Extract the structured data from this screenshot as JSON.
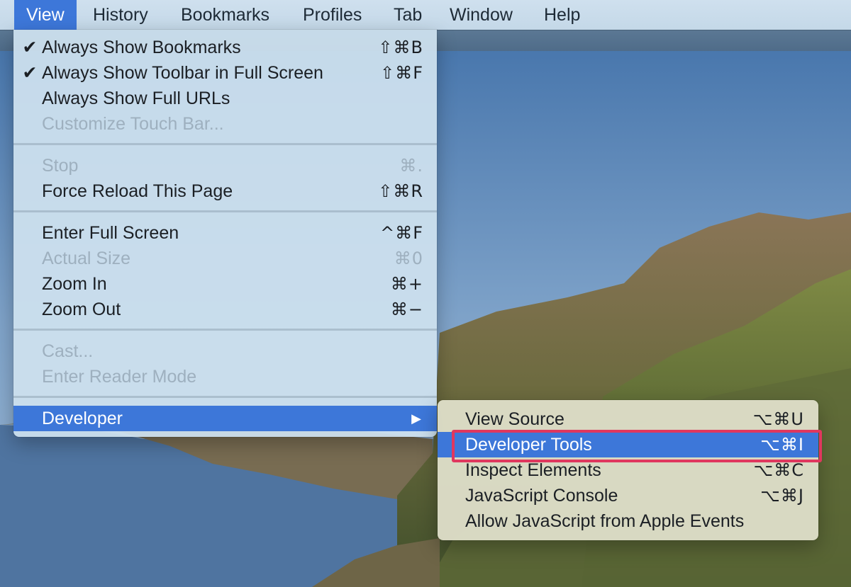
{
  "menubar": {
    "items": [
      "View",
      "History",
      "Bookmarks",
      "Profiles",
      "Tab",
      "Window",
      "Help"
    ],
    "active": "View"
  },
  "view_menu": {
    "groups": [
      [
        {
          "label": "Always Show Bookmarks",
          "shortcut": "⇧⌘B",
          "checked": true,
          "enabled": true
        },
        {
          "label": "Always Show Toolbar in Full Screen",
          "shortcut": "⇧⌘F",
          "checked": true,
          "enabled": true
        },
        {
          "label": "Always Show Full URLs",
          "shortcut": "",
          "checked": false,
          "enabled": true
        },
        {
          "label": "Customize Touch Bar...",
          "shortcut": "",
          "checked": false,
          "enabled": false
        }
      ],
      [
        {
          "label": "Stop",
          "shortcut": "⌘.",
          "checked": false,
          "enabled": false
        },
        {
          "label": "Force Reload This Page",
          "shortcut": "⇧⌘R",
          "checked": false,
          "enabled": true
        }
      ],
      [
        {
          "label": "Enter Full Screen",
          "shortcut": "^⌘F",
          "checked": false,
          "enabled": true
        },
        {
          "label": "Actual Size",
          "shortcut": "⌘0",
          "checked": false,
          "enabled": false
        },
        {
          "label": "Zoom In",
          "shortcut": "⌘+",
          "checked": false,
          "enabled": true
        },
        {
          "label": "Zoom Out",
          "shortcut": "⌘−",
          "checked": false,
          "enabled": true
        }
      ],
      [
        {
          "label": "Cast...",
          "shortcut": "",
          "checked": false,
          "enabled": false
        },
        {
          "label": "Enter Reader Mode",
          "shortcut": "",
          "checked": false,
          "enabled": false
        }
      ]
    ],
    "developer": {
      "label": "Developer",
      "submenu_arrow": "▶"
    }
  },
  "developer_submenu": {
    "items": [
      {
        "label": "View Source",
        "shortcut": "⌥⌘U",
        "highlighted": false
      },
      {
        "label": "Developer Tools",
        "shortcut": "⌥⌘I",
        "highlighted": true
      },
      {
        "label": "Inspect Elements",
        "shortcut": "⌥⌘C",
        "highlighted": false
      },
      {
        "label": "JavaScript Console",
        "shortcut": "⌥⌘J",
        "highlighted": false
      },
      {
        "label": "Allow JavaScript from Apple Events",
        "shortcut": "",
        "highlighted": false
      }
    ]
  },
  "icons": {
    "checkmark": "checkmark-icon",
    "submenu_arrow": "triangle-right-icon"
  },
  "colors": {
    "highlight": "#3d77d9",
    "focus_outline": "#e0375e",
    "menu_bg": "#cde0ee",
    "submenu_bg": "#dedec8",
    "disabled_text": "#9eb0bf"
  }
}
